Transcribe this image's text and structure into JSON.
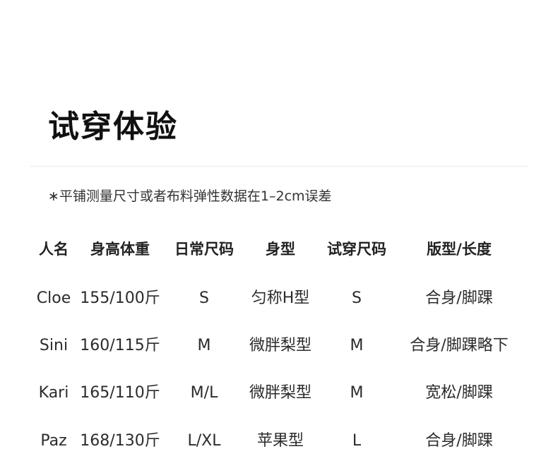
{
  "title": "试穿体验",
  "note": "∗平铺测量尺寸或者布料弹性数据在1–2cm误差",
  "table": {
    "headers": [
      "人名",
      "身高体重",
      "日常尺码",
      "身型",
      "试穿尺码",
      "版型/长度"
    ],
    "rows": [
      [
        "Cloe",
        "155/100斤",
        "S",
        "匀称H型",
        "S",
        "合身/脚踝"
      ],
      [
        "Sini",
        "160/115斤",
        "M",
        "微胖梨型",
        "M",
        "合身/脚踝略下"
      ],
      [
        "Kari",
        "165/110斤",
        "M/L",
        "微胖梨型",
        "M",
        "宽松/脚踝"
      ],
      [
        "Paz",
        "168/130斤",
        "L/XL",
        "苹果型",
        "L",
        "合身/脚踝"
      ]
    ]
  }
}
